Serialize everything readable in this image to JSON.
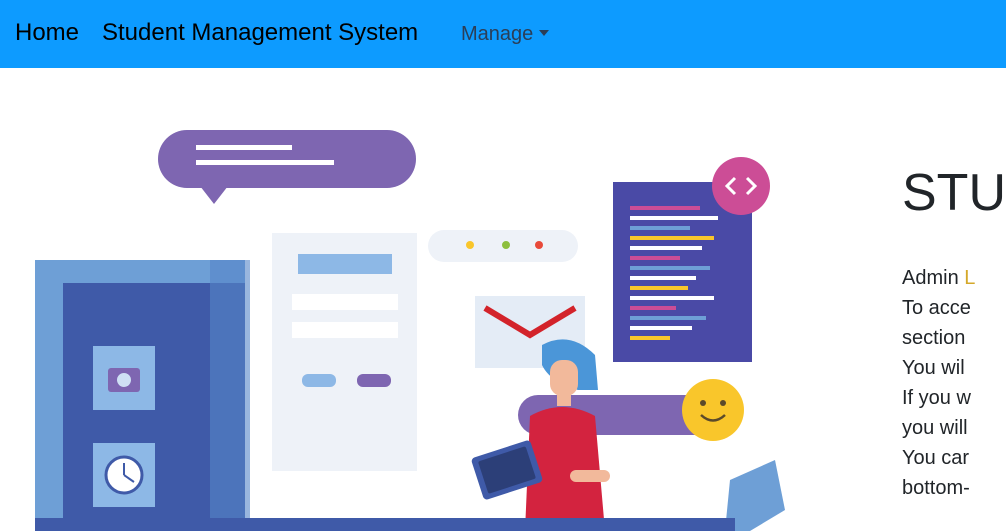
{
  "navbar": {
    "home_label": "Home",
    "brand_label": "Student Management System",
    "manage_label": "Manage"
  },
  "illustration": {
    "semantic": "web-developer-illustration",
    "colors": {
      "purple": "#7e66b1",
      "blue_dark": "#3f5aa8",
      "blue_light": "#6e9fd6",
      "pink": "#cc4d96",
      "yellow": "#f9c62b",
      "red": "#d3232a"
    }
  },
  "main": {
    "heading": "STU",
    "list_items": [
      {
        "line1": "Admin ",
        "highlight": "L"
      },
      {
        "line1": "To acce",
        "line2": "section"
      },
      {
        "line1": "You wil"
      },
      {
        "line1": "If you w",
        "line2": "you will"
      },
      {
        "line1": "You car",
        "line2": "bottom-"
      }
    ]
  }
}
